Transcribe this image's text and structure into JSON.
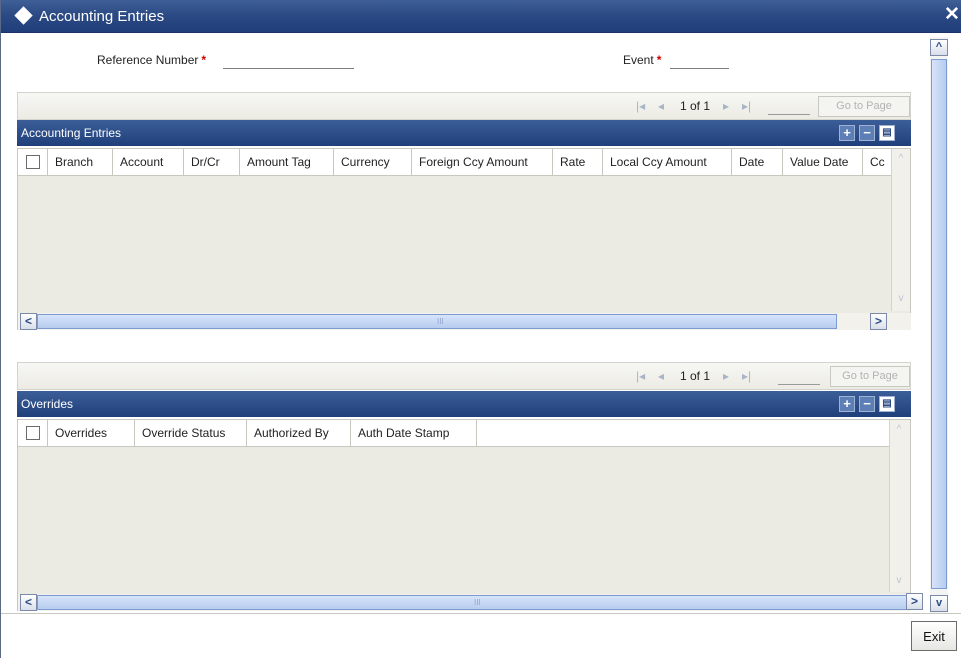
{
  "window": {
    "title": "Accounting Entries",
    "close_glyph": "✕"
  },
  "form": {
    "reference_number_label": "Reference Number",
    "event_label": "Event",
    "required_marker": "*",
    "reference_number_value": "",
    "event_value": ""
  },
  "accounting_entries": {
    "pager": {
      "first": "|◂",
      "prev": "◂",
      "page_text": "1 of 1",
      "next": "▸",
      "last": "▸|",
      "goto_value": "",
      "goto_label": "Go to Page"
    },
    "header_title": "Accounting Entries",
    "header_buttons": {
      "add": "+",
      "remove": "−",
      "view": "▤"
    },
    "columns": [
      "Branch",
      "Account",
      "Dr/Cr",
      "Amount Tag",
      "Currency",
      "Foreign Ccy Amount",
      "Rate",
      "Local Ccy Amount",
      "Date",
      "Value Date",
      "Cc"
    ],
    "rows": []
  },
  "overrides": {
    "pager": {
      "first": "|◂",
      "prev": "◂",
      "page_text": "1 of 1",
      "next": "▸",
      "last": "▸|",
      "goto_value": "",
      "goto_label": "Go to Page"
    },
    "header_title": "Overrides",
    "header_buttons": {
      "add": "+",
      "remove": "−",
      "view": "▤"
    },
    "columns": [
      "Overrides",
      "Override Status",
      "Authorized By",
      "Auth Date Stamp"
    ],
    "rows": []
  },
  "scroll_glyphs": {
    "left": "<",
    "right": ">",
    "up": "^",
    "down": "v",
    "thumb_grip": "III"
  },
  "footer": {
    "exit_label": "Exit"
  },
  "colors": {
    "title_bar": "#2c4b85",
    "grid_header": "#2c4b85",
    "required": "#d00000",
    "grid_bg": "#ebeae3"
  }
}
